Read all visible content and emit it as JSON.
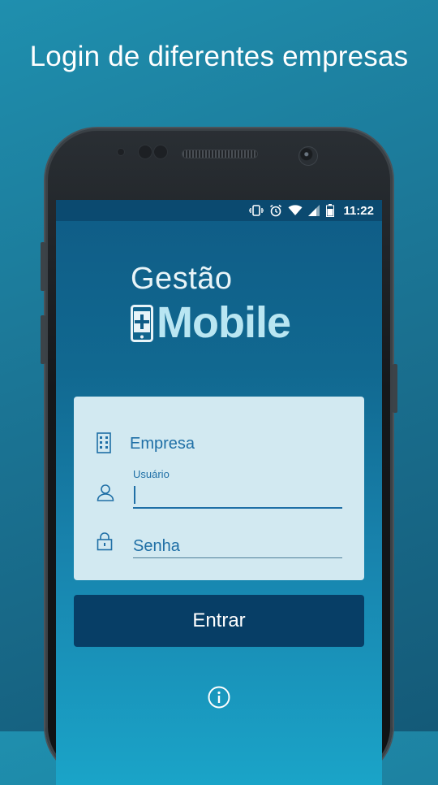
{
  "headline": "Login de diferentes empresas",
  "status_bar": {
    "time": "11:22",
    "icons": [
      "vibrate-icon",
      "alarm-icon",
      "wifi-icon",
      "signal-icon",
      "battery-icon"
    ]
  },
  "logo": {
    "line1": "Gestão",
    "line2": "Mobile"
  },
  "form": {
    "empresa_label": "Empresa",
    "usuario_label": "Usuário",
    "usuario_value": "",
    "senha_placeholder": "Senha"
  },
  "button": {
    "entrar_label": "Entrar"
  },
  "colors": {
    "accent": "#1f6fa6",
    "button_bg": "#073e66",
    "card_bg": "#d2e9f1",
    "logo_light": "#b9e6f2"
  }
}
